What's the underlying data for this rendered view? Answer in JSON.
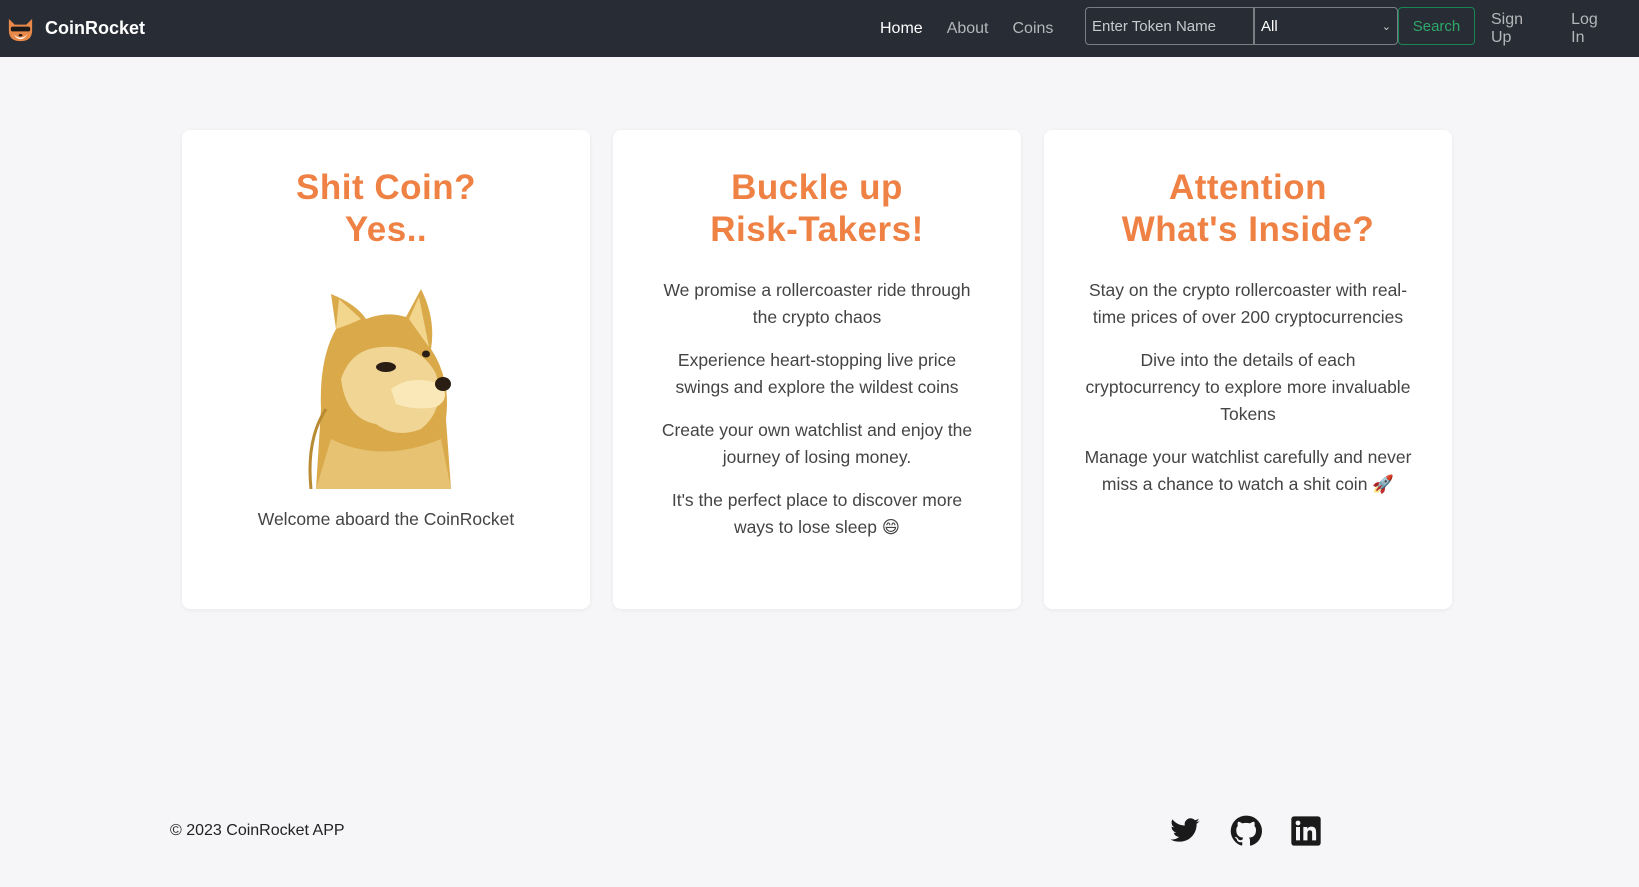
{
  "nav": {
    "brand": "CoinRocket",
    "links": [
      "Home",
      "About",
      "Coins"
    ],
    "search_placeholder": "Enter Token Name",
    "category_selected": "All",
    "search_label": "Search",
    "signup": "Sign Up",
    "login": "Log In"
  },
  "cards": [
    {
      "title": "Shit Coin?\nYes..",
      "caption": "Welcome aboard the CoinRocket"
    },
    {
      "title": "Buckle up\nRisk-Takers!",
      "paragraphs": [
        "We promise a rollercoaster ride through the crypto chaos",
        "Experience heart-stopping live price swings and explore the wildest coins",
        "Create your own watchlist and enjoy the journey of losing money.",
        "It's the perfect place to discover more ways to lose sleep 😄"
      ]
    },
    {
      "title": "Attention\nWhat's Inside?",
      "paragraphs": [
        "Stay on the crypto rollercoaster with real-time prices of over 200 cryptocurrencies",
        "Dive into the details of each cryptocurrency to explore more invaluable Tokens",
        "Manage your watchlist carefully and never miss a chance to watch a shit coin 🚀"
      ]
    }
  ],
  "footer": {
    "copyright": "© 2023 CoinRocket APP",
    "social_icons": [
      "twitter-icon",
      "github-icon",
      "linkedin-icon"
    ]
  },
  "colors": {
    "navbar": "#282c34",
    "accent_orange": "#ee8143",
    "search_green": "#198754",
    "page_bg": "#f6f6f8"
  }
}
